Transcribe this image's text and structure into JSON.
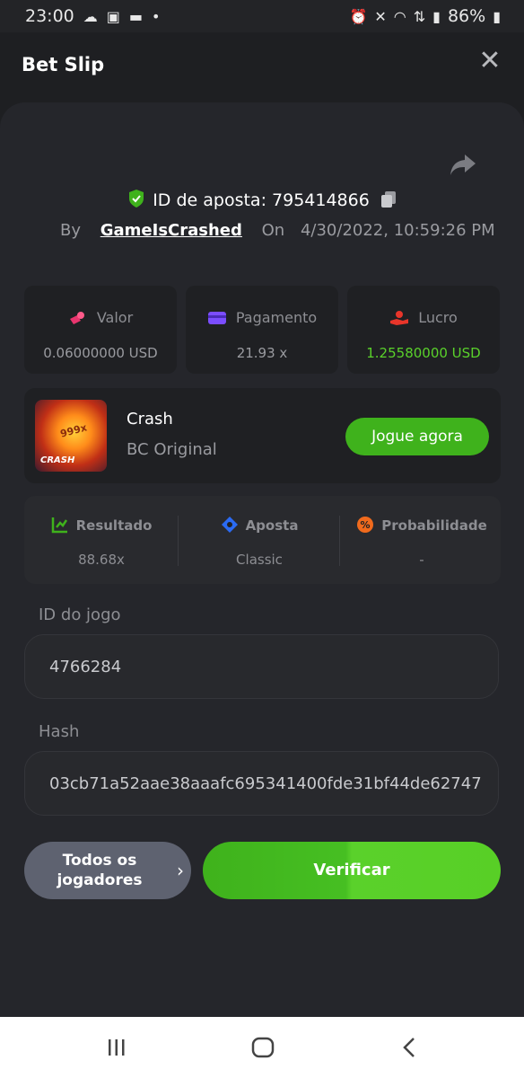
{
  "status_bar": {
    "time": "23:00",
    "battery": "86%",
    "icons_left": [
      "cloud-icon",
      "image-icon",
      "chat-icon",
      "dot-icon"
    ],
    "icons_right": [
      "alarm-icon",
      "mute-icon",
      "wifi-icon",
      "network-icon",
      "signal-icon",
      "battery-icon"
    ]
  },
  "header": {
    "title": "Bet Slip"
  },
  "bet": {
    "id_text": "ID de aposta: 795414866",
    "by_label": "By",
    "user": "GameIsCrashed",
    "on_label": "On",
    "datetime": "4/30/2022, 10:59:26 PM"
  },
  "stats": [
    {
      "label": "Valor",
      "value": "0.06000000 USD",
      "icon": "coins-icon"
    },
    {
      "label": "Pagamento",
      "value": "21.93 x",
      "icon": "wallet-icon"
    },
    {
      "label": "Lucro",
      "value": "1.25580000 USD",
      "icon": "profit-hand-icon",
      "color": "#5ad12b"
    }
  ],
  "game": {
    "name": "Crash",
    "subtitle": "BC Original",
    "thumb_multiplier": "999x",
    "thumb_label": "CRASH",
    "play_label": "Jogue agora"
  },
  "result": [
    {
      "label": "Resultado",
      "value": "88.68x",
      "icon": "chart-check-icon"
    },
    {
      "label": "Aposta",
      "value": "Classic",
      "icon": "diamond-icon"
    },
    {
      "label": "Probabilidade",
      "value": "-",
      "icon": "percent-icon"
    }
  ],
  "fields": {
    "game_id_label": "ID do jogo",
    "game_id_value": "4766284",
    "hash_label": "Hash",
    "hash_value": "03cb71a52aae38aaafc695341400fde31bf44de62747"
  },
  "actions": {
    "all_players": "Todos os jogadores",
    "verify": "Verificar"
  },
  "colors": {
    "accent_green": "#3fb21c",
    "profit_green": "#5ad12b",
    "background": "#1e1f22"
  }
}
